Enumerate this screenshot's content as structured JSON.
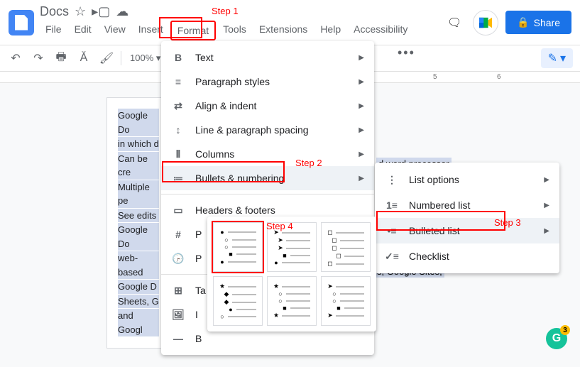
{
  "header": {
    "doc_title": "Docs",
    "share_label": "Share"
  },
  "menubar": [
    "File",
    "Edit",
    "View",
    "Insert",
    "Format",
    "Tools",
    "Extensions",
    "Help",
    "Accessibility"
  ],
  "toolbar": {
    "zoom": "100%"
  },
  "ruler_right": [
    "5",
    "6"
  ],
  "document_lines": [
    "Google Do",
    "in which d",
    "Can be cre",
    "Multiple pe",
    "See edits",
    "Google Do",
    "web-based",
    " Google D",
    "Sheets, G",
    "and Googl"
  ],
  "document_right_fragments": [
    "d word processor",
    "s, Google Sites,"
  ],
  "format_menu": [
    {
      "icon": "B",
      "label": "Text",
      "arrow": true
    },
    {
      "icon": "≡",
      "label": "Paragraph styles",
      "arrow": true
    },
    {
      "icon": "⇄",
      "label": "Align & indent",
      "arrow": true
    },
    {
      "icon": "↕",
      "label": "Line & paragraph spacing",
      "arrow": true
    },
    {
      "icon": "⦀",
      "label": "Columns",
      "arrow": true
    },
    {
      "icon": "≔",
      "label": "Bullets & numbering",
      "arrow": true,
      "active": true
    },
    {
      "sep": true
    },
    {
      "icon": "▭",
      "label": "Headers & footers",
      "arrow": false
    },
    {
      "icon": "#",
      "label": "P",
      "arrow": false
    },
    {
      "icon": "🕞",
      "label": "P",
      "arrow": false
    },
    {
      "sep": true
    },
    {
      "icon": "⊞",
      "label": "Ta",
      "arrow": false
    },
    {
      "icon": "🖼",
      "label": "I",
      "arrow": false
    },
    {
      "icon": "―",
      "label": "B",
      "arrow": false
    }
  ],
  "bullets_submenu": [
    {
      "icon": "⋮",
      "label": "List options",
      "arrow": true
    },
    {
      "icon": "1≡",
      "label": "Numbered list",
      "arrow": true
    },
    {
      "icon": "•≡",
      "label": "Bulleted list",
      "arrow": true,
      "active": true
    },
    {
      "icon": "✓≡",
      "label": "Checklist",
      "arrow": false
    }
  ],
  "bullet_presets": [
    [
      [
        "●",
        ""
      ],
      [
        "○",
        "  "
      ],
      [
        "○",
        "  "
      ],
      [
        "■",
        "    "
      ],
      [
        "●",
        ""
      ]
    ],
    [
      [
        "➤",
        ""
      ],
      [
        "➤",
        "  "
      ],
      [
        "➤",
        "  "
      ],
      [
        "■",
        "    "
      ],
      [
        "●",
        ""
      ]
    ],
    [
      [
        "◻",
        ""
      ],
      [
        "◻",
        "  "
      ],
      [
        "◻",
        "  "
      ],
      [
        "◻",
        "    "
      ],
      [
        "◻",
        ""
      ]
    ],
    [
      [
        "★",
        ""
      ],
      [
        "◆",
        "  "
      ],
      [
        "◆",
        "  "
      ],
      [
        "●",
        "    "
      ],
      [
        "○",
        ""
      ]
    ],
    [
      [
        "★",
        ""
      ],
      [
        "○",
        "  "
      ],
      [
        "○",
        "  "
      ],
      [
        "■",
        "    "
      ],
      [
        "★",
        ""
      ]
    ],
    [
      [
        "➤",
        ""
      ],
      [
        "○",
        "  "
      ],
      [
        "○",
        "  "
      ],
      [
        "■",
        "    "
      ],
      [
        "➤",
        ""
      ]
    ]
  ],
  "steps": {
    "s1": "Step 1",
    "s2": "Step 2",
    "s3": "Step 3",
    "s4": "Step 4"
  }
}
